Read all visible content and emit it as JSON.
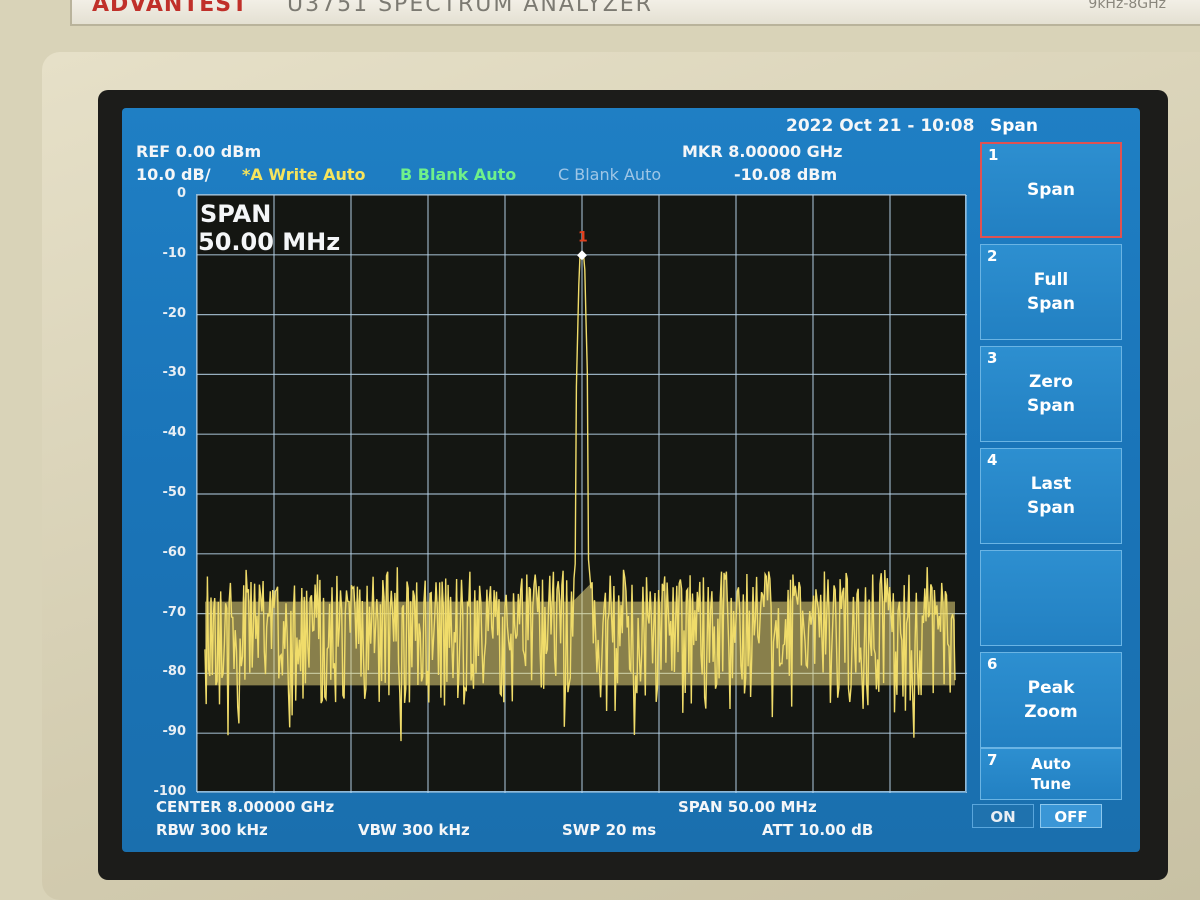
{
  "instrument": {
    "brand": "ADVANTEST",
    "model": "U3751 SPECTRUM ANALYZER",
    "freq_range": "9kHz-8GHz"
  },
  "header": {
    "datetime": "2022 Oct 21 - 10:08",
    "ref_level": "REF  0.00 dBm",
    "scale": "10.0 dB/",
    "trace_a": "*A Write Auto",
    "trace_b": "B Blank Auto",
    "trace_c": "C Blank Auto",
    "marker_freq": "MKR  8.00000 GHz",
    "marker_level": "-10.08 dBm"
  },
  "plot": {
    "overlay_label": "SPAN",
    "overlay_value": "50.00 MHz",
    "marker_number": "1",
    "y_ticks": [
      "0",
      "-10",
      "-20",
      "-30",
      "-40",
      "-50",
      "-60",
      "-70",
      "-80",
      "-90",
      "-100"
    ]
  },
  "footer": {
    "center_freq": "CENTER 8.00000 GHz",
    "span": "SPAN  50.00 MHz",
    "rbw": "RBW  300 kHz",
    "vbw": "VBW  300 kHz",
    "swp": "SWP  20 ms",
    "att": "ATT  10.00 dB"
  },
  "softkeys": {
    "menu_title": "Span",
    "items": [
      {
        "num": "1",
        "label": "Span"
      },
      {
        "num": "2",
        "label": "Full\nSpan"
      },
      {
        "num": "3",
        "label": "Zero\nSpan"
      },
      {
        "num": "4",
        "label": "Last\nSpan"
      },
      {
        "num": "",
        "label": ""
      },
      {
        "num": "6",
        "label": "Peak\nZoom"
      },
      {
        "num": "7",
        "label": "Auto\nTune"
      }
    ],
    "toggle_on": "ON",
    "toggle_off": "OFF"
  },
  "colors": {
    "screen_blue": "#1f7fc4",
    "trace_yellow": "#f0dc6a",
    "marker_red": "#e0401e",
    "grid": "#b8d4ea"
  },
  "chart_data": {
    "type": "line",
    "title": "",
    "xlabel": "",
    "ylabel": "",
    "x_center_ghz": 8.0,
    "x_span_mhz": 50.0,
    "ylim": [
      -100,
      0
    ],
    "y_unit": "dBm",
    "grid": true,
    "series": [
      {
        "name": "A",
        "peak_freq_ghz": 8.0,
        "peak_level_dbm": -10.08,
        "noise_floor_dbm_range": [
          -92,
          -62
        ]
      }
    ]
  }
}
